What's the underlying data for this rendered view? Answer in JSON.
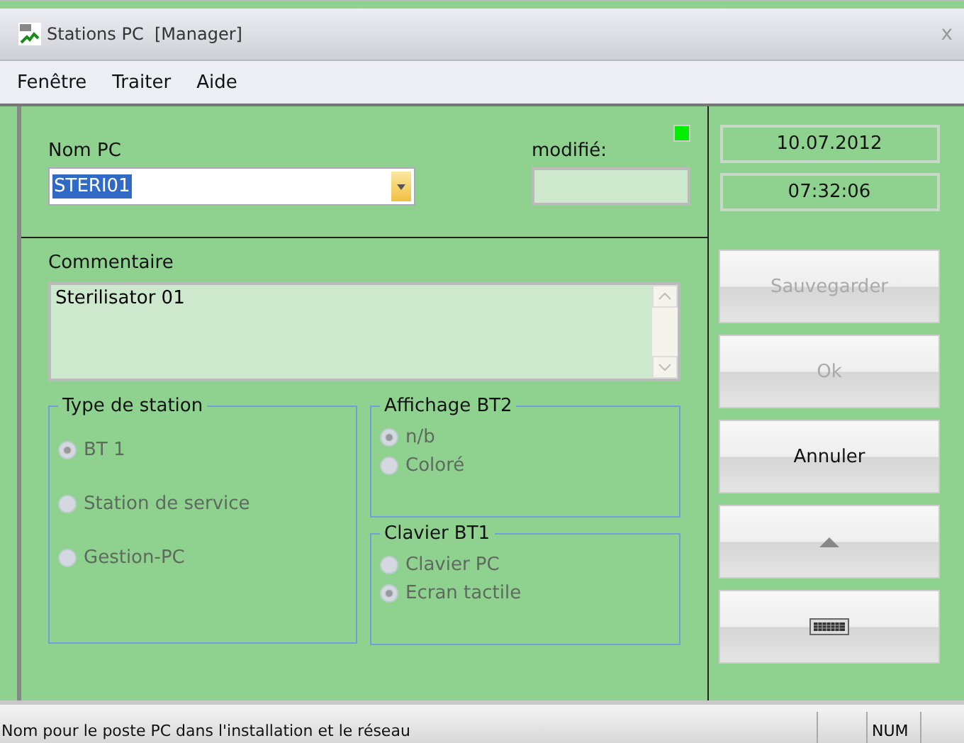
{
  "window": {
    "title": "Stations PC  [Manager]",
    "close": "x"
  },
  "menu": [
    {
      "label": "Fenêtre"
    },
    {
      "label": "Traiter"
    },
    {
      "label": "Aide"
    }
  ],
  "form": {
    "name_label": "Nom PC",
    "name_value": "STERI01",
    "modified_label": "modifié:",
    "status_led": {
      "on": true
    },
    "comment_label": "Commentaire",
    "comment_value": "Sterilisator 01"
  },
  "groups": [
    {
      "title": "Type de station",
      "disabled": true,
      "options": [
        {
          "label": "BT 1",
          "selected": true
        },
        {
          "label": "Station de service",
          "selected": false
        },
        {
          "label": "Gestion-PC",
          "selected": false
        }
      ]
    },
    {
      "title": "Affichage BT2",
      "disabled": true,
      "options": [
        {
          "label": "n/b",
          "selected": true
        },
        {
          "label": "Coloré",
          "selected": false
        }
      ]
    },
    {
      "title": "Clavier BT1",
      "disabled": true,
      "options": [
        {
          "label": "Clavier PC",
          "selected": false
        },
        {
          "label": "Ecran tactile",
          "selected": true
        }
      ]
    }
  ],
  "side": {
    "date": "10.07.2012",
    "time": "07:32:06"
  },
  "buttons": [
    {
      "kind": "text",
      "label": "Sauvegarder",
      "disabled": true
    },
    {
      "kind": "text",
      "label": "Ok",
      "disabled": true
    },
    {
      "kind": "text",
      "label": "Annuler",
      "disabled": false
    },
    {
      "kind": "up",
      "disabled": false
    },
    {
      "kind": "keyboard",
      "disabled": false
    }
  ],
  "status_bar": {
    "message": "Nom pour le poste PC dans l'installation et le réseau",
    "num": "NUM"
  }
}
